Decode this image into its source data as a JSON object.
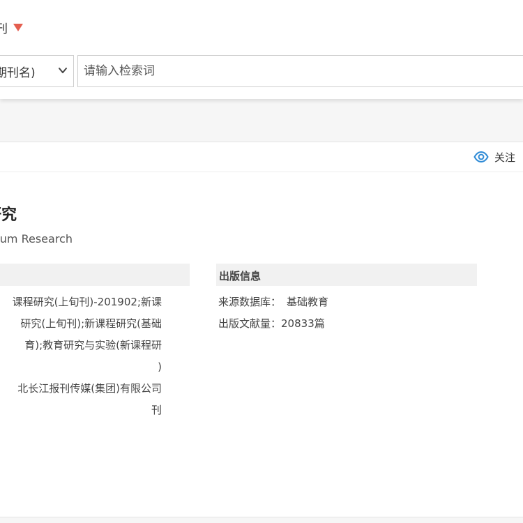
{
  "header": {
    "scope_label": "刊",
    "search": {
      "field_select": "期刊名)",
      "placeholder": "请输入检索词"
    }
  },
  "card": {
    "follow_label": "关注",
    "journal_title": "研究",
    "journal_title_en": "lum Research",
    "sections": {
      "basic_info_title": "",
      "publish_info_title": "出版信息"
    },
    "basic_info_lines": [
      "课程研究(上旬刊)-201902;新课",
      "研究(上旬刊);新课程研究(基础",
      "育);教育研究与实验(新课程研",
      ")",
      "北长江报刊传媒(集团)有限公司",
      "刊"
    ],
    "publish_info": {
      "source_db_label": "来源数据库：",
      "source_db_value": "基础教育",
      "article_count_label": "出版文献量：",
      "article_count_value": "20833篇"
    }
  },
  "colors": {
    "accent_red": "#e45e4f",
    "eye_icon_blue": "#2f8bd6"
  }
}
